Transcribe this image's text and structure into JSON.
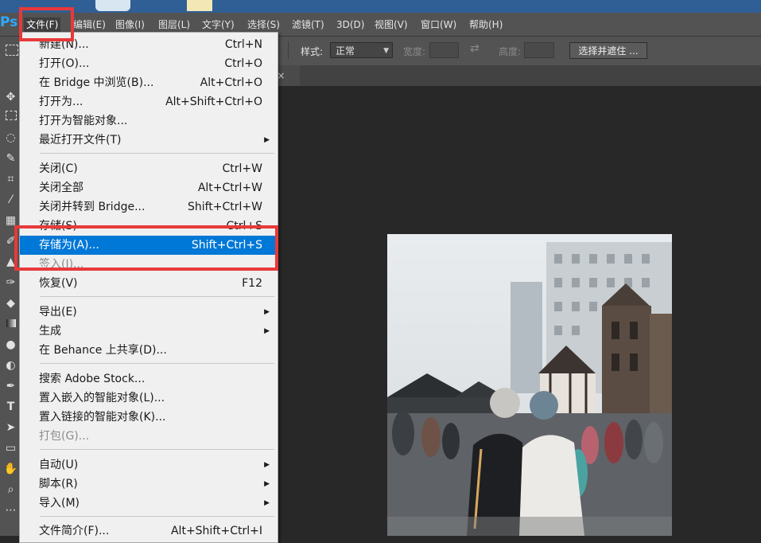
{
  "app": {
    "logo": "Ps"
  },
  "menubar": {
    "items": [
      "文件(F)",
      "编辑(E)",
      "图像(I)",
      "图层(L)",
      "文字(Y)",
      "选择(S)",
      "滤镜(T)",
      "3D(D)",
      "视图(V)",
      "窗口(W)",
      "帮助(H)"
    ]
  },
  "options_bar": {
    "style_label": "样式:",
    "style_value": "正常",
    "width_label": "宽度:",
    "height_label": "高度:",
    "select_mask_button": "选择并遮住 ..."
  },
  "tab_bar": {
    "doc_tab_text": "* ×"
  },
  "file_menu": {
    "items": [
      {
        "label": "新建(N)...",
        "shortcut": "Ctrl+N"
      },
      {
        "label": "打开(O)...",
        "shortcut": "Ctrl+O"
      },
      {
        "label": "在 Bridge 中浏览(B)...",
        "shortcut": "Alt+Ctrl+O"
      },
      {
        "label": "打开为...",
        "shortcut": "Alt+Shift+Ctrl+O"
      },
      {
        "label": "打开为智能对象...",
        "shortcut": ""
      },
      {
        "label": "最近打开文件(T)",
        "shortcut": "",
        "submenu": true
      },
      {
        "label": "关闭(C)",
        "shortcut": "Ctrl+W"
      },
      {
        "label": "关闭全部",
        "shortcut": "Alt+Ctrl+W"
      },
      {
        "label": "关闭并转到 Bridge...",
        "shortcut": "Shift+Ctrl+W"
      },
      {
        "label": "存储(S)",
        "shortcut": "Ctrl+S"
      },
      {
        "label": "存储为(A)...",
        "shortcut": "Shift+Ctrl+S",
        "highlighted": true
      },
      {
        "label": "签入(I)...",
        "shortcut": "",
        "disabled": true
      },
      {
        "label": "恢复(V)",
        "shortcut": "F12"
      },
      {
        "label": "导出(E)",
        "shortcut": "",
        "submenu": true
      },
      {
        "label": "生成",
        "shortcut": "",
        "submenu": true
      },
      {
        "label": "在 Behance 上共享(D)...",
        "shortcut": ""
      },
      {
        "label": "搜索 Adobe Stock...",
        "shortcut": ""
      },
      {
        "label": "置入嵌入的智能对象(L)...",
        "shortcut": ""
      },
      {
        "label": "置入链接的智能对象(K)...",
        "shortcut": ""
      },
      {
        "label": "打包(G)...",
        "shortcut": "",
        "disabled": true
      },
      {
        "label": "自动(U)",
        "shortcut": "",
        "submenu": true
      },
      {
        "label": "脚本(R)",
        "shortcut": "",
        "submenu": true
      },
      {
        "label": "导入(M)",
        "shortcut": "",
        "submenu": true
      },
      {
        "label": "文件简介(F)...",
        "shortcut": "Alt+Shift+Ctrl+I"
      }
    ]
  },
  "toolbar": {
    "tools": [
      "move-tool-icon",
      "marquee-tool-icon",
      "lasso-tool-icon",
      "quick-select-tool-icon",
      "crop-tool-icon",
      "eyedropper-tool-icon",
      "healing-brush-tool-icon",
      "brush-tool-icon",
      "clone-stamp-tool-icon",
      "history-brush-tool-icon",
      "eraser-tool-icon",
      "gradient-tool-icon",
      "blur-tool-icon",
      "dodge-tool-icon",
      "pen-tool-icon",
      "type-tool-icon",
      "path-select-tool-icon",
      "rectangle-tool-icon",
      "hand-tool-icon",
      "zoom-tool-icon",
      "more-tools-icon"
    ]
  },
  "colors": {
    "highlight": "#0078d7",
    "annotation_red": "#e8393a",
    "panel": "#535353",
    "canvas": "#282828"
  }
}
